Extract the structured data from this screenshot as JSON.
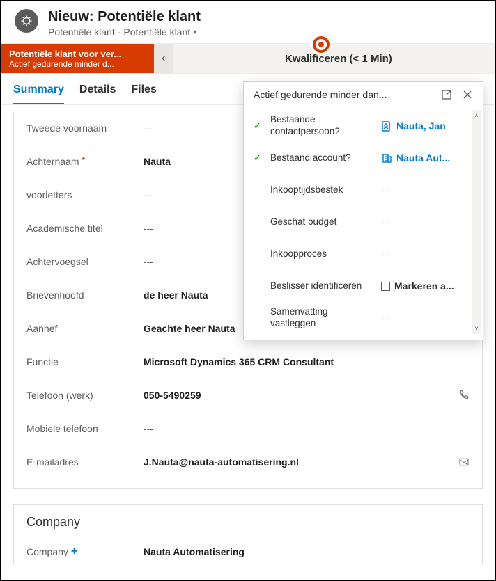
{
  "header": {
    "title": "Nieuw: Potentiële klant",
    "breadcrumb1": "Potentiële klant",
    "breadcrumb_sep": "·",
    "breadcrumb2": "Potentiële klant"
  },
  "stage": {
    "active_title": "Potentiële klant voor ver...",
    "active_sub": "Actief gedurende minder d...",
    "next": "Kwalificeren  (< 1 Min)"
  },
  "tabs": {
    "summary": "Summary",
    "details": "Details",
    "files": "Files"
  },
  "fields": {
    "tweede_voornaam": {
      "label": "Tweede voornaam",
      "value": "---"
    },
    "achternaam": {
      "label": "Achternaam",
      "value": "Nauta"
    },
    "voorletters": {
      "label": "voorletters",
      "value": "---"
    },
    "academische_titel": {
      "label": "Academische titel",
      "value": "---"
    },
    "achtervoegsel": {
      "label": "Achtervoegsel",
      "value": "---"
    },
    "brievenhoofd": {
      "label": "Brievenhoofd",
      "value": "de heer Nauta"
    },
    "aanhef": {
      "label": "Aanhef",
      "value": "Geachte heer Nauta"
    },
    "functie": {
      "label": "Functie",
      "value": "Microsoft Dynamics 365 CRM Consultant"
    },
    "telefoon_werk": {
      "label": "Telefoon (werk)",
      "value": "050-5490259"
    },
    "mobiele_telefoon": {
      "label": "Mobiele telefoon",
      "value": "---"
    },
    "emailadres": {
      "label": "E-mailadres",
      "value": "J.Nauta@nauta-automatisering.nl"
    }
  },
  "company_section": {
    "title": "Company",
    "company": {
      "label": "Company",
      "value": "Nauta Automatisering"
    }
  },
  "flyout": {
    "title": "Actief gedurende minder dan...",
    "rows": {
      "bestaande_contact": {
        "label": "Bestaande contactpersoon?",
        "value": "Nauta, Jan"
      },
      "bestaand_account": {
        "label": "Bestaand account?",
        "value": "Nauta Aut..."
      },
      "inkooptijdsbestek": {
        "label": "Inkooptijdsbestek",
        "value": "---"
      },
      "geschat_budget": {
        "label": "Geschat budget",
        "value": "---"
      },
      "inkoopproces": {
        "label": "Inkoopproces",
        "value": "---"
      },
      "beslisser": {
        "label": "Beslisser identificeren",
        "value": "Markeren a..."
      },
      "samenvatting": {
        "label": "Samenvatting vastleggen",
        "value": "---"
      }
    }
  },
  "marks": {
    "required": "*",
    "recommended": "+"
  }
}
